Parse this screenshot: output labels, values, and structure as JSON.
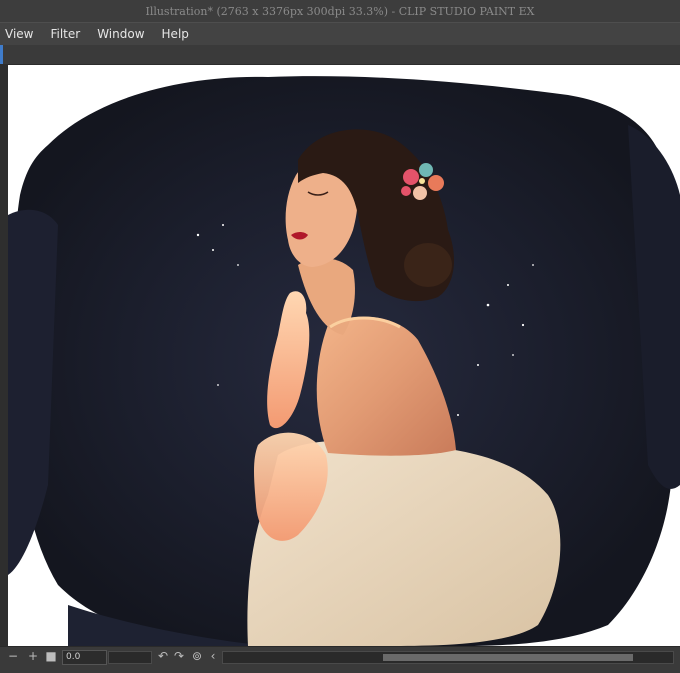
{
  "window": {
    "title": "Illustration* (2763 x 3376px 300dpi 33.3%)  -  CLIP STUDIO PAINT EX"
  },
  "menu": {
    "items": [
      "View",
      "Filter",
      "Window",
      "Help"
    ]
  },
  "status": {
    "rotation_value": "0.0"
  },
  "colors": {
    "accent": "#3f7ccb",
    "canvas_background": "#ffffff",
    "night_sky": "#1a1d2b",
    "skin": "#e4a07a",
    "fur": "#e8d8c4",
    "hair": "#2a1a14",
    "lips": "#b0182a"
  },
  "icons": [
    "zoom-out-icon",
    "zoom-in-icon",
    "stop-icon",
    "rotate-left-icon",
    "rotate-right-icon",
    "reset-rotation-icon",
    "scroll-left-icon"
  ]
}
